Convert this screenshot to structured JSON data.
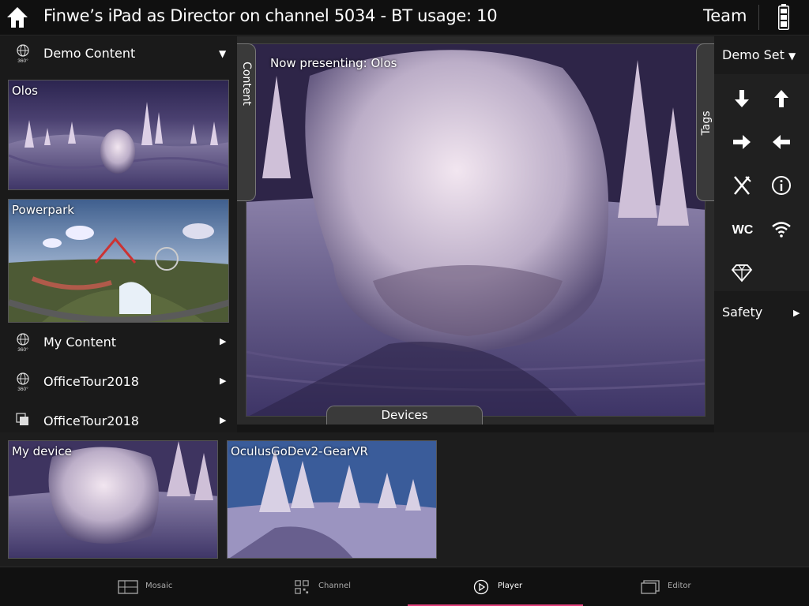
{
  "header": {
    "title": "Finwe’s iPad as Director on channel 5034 - BT usage: 10",
    "team_label": "Team"
  },
  "left_panel": {
    "demo_content": {
      "label": "Demo Content",
      "icon": "360-globe-icon"
    },
    "thumbnails": [
      {
        "label": "Olos"
      },
      {
        "label": "Powerpark"
      }
    ],
    "folders": [
      {
        "label": "My Content",
        "icon": "360-globe-icon"
      },
      {
        "label": "OfficeTour2018",
        "icon": "360-globe-icon"
      },
      {
        "label": "OfficeTour2018",
        "icon": "stack-icon"
      }
    ]
  },
  "center": {
    "now_presenting": "Now presenting: Olos",
    "tab_content": "Content",
    "tab_tags": "Tags",
    "tab_devices": "Devices"
  },
  "right_panel": {
    "set_label": "Demo Set",
    "safety_label": "Safety",
    "tags": [
      {
        "icon": "arrow-down-icon"
      },
      {
        "icon": "arrow-up-icon"
      },
      {
        "icon": "arrow-right-icon"
      },
      {
        "icon": "arrow-left-icon"
      },
      {
        "icon": "restaurant-icon"
      },
      {
        "icon": "info-icon"
      },
      {
        "icon": "wc-icon",
        "text": "WC"
      },
      {
        "icon": "wifi-icon"
      },
      {
        "icon": "diamond-icon"
      }
    ]
  },
  "devices": [
    {
      "label": "My device"
    },
    {
      "label": "OculusGoDev2-GearVR"
    }
  ],
  "bottom_tabs": [
    {
      "label": "Mosaic",
      "icon": "mosaic-icon"
    },
    {
      "label": "Channel",
      "icon": "qr-code-icon"
    },
    {
      "label": "Player",
      "icon": "play-icon",
      "active": true
    },
    {
      "label": "Editor",
      "icon": "editor-icon"
    }
  ],
  "colors": {
    "accent": "#e0407a",
    "background": "#151515"
  }
}
